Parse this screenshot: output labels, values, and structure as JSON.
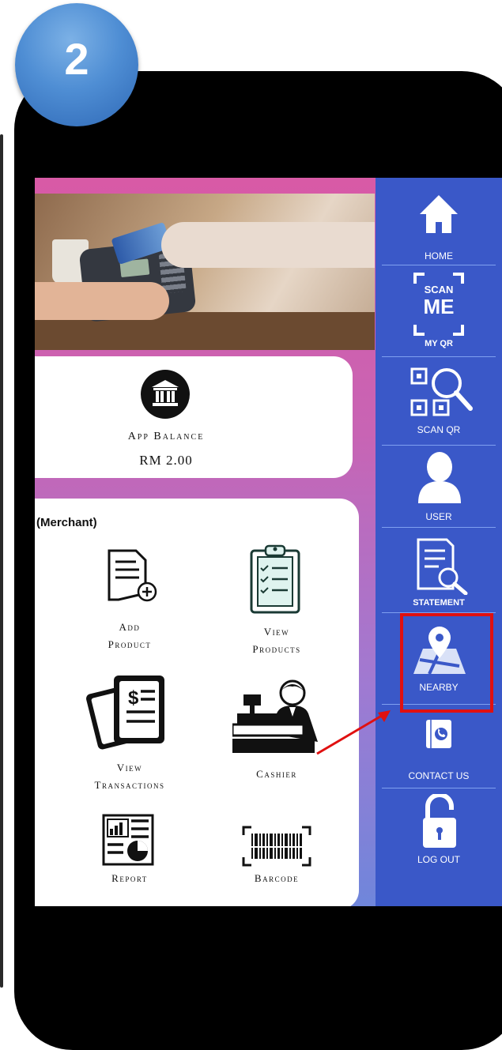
{
  "step_badge": "2",
  "balance": {
    "label": "App Balance",
    "value": "RM 2.00",
    "icon": "bank-icon"
  },
  "merchant_title": "(Merchant)",
  "tiles": [
    {
      "label": "Add\nProduct",
      "icon": "add-product-icon"
    },
    {
      "label": "View\nProducts",
      "icon": "view-products-icon"
    },
    {
      "label": "View\nTransactions",
      "icon": "view-transactions-icon"
    },
    {
      "label": "Cashier",
      "icon": "cashier-icon"
    },
    {
      "label": "Report",
      "icon": "report-icon"
    },
    {
      "label": "Barcode",
      "icon": "barcode-icon"
    }
  ],
  "sidebar": {
    "items": [
      {
        "label": "HOME",
        "icon": "home-icon"
      },
      {
        "label": "MY QR",
        "icon": "scan-me-qr-icon",
        "badge_top": "SCAN",
        "badge_main": "ME"
      },
      {
        "label": "SCAN QR",
        "icon": "scan-qr-icon"
      },
      {
        "label": "USER",
        "icon": "user-icon"
      },
      {
        "label": "STATEMENT",
        "icon": "statement-icon"
      },
      {
        "label": "NEARBY",
        "icon": "map-pin-icon"
      },
      {
        "label": "CONTACT US",
        "icon": "phone-icon"
      },
      {
        "label": "LOG OUT",
        "icon": "padlock-icon"
      }
    ],
    "highlighted_item": "NEARBY"
  },
  "colors": {
    "sidebar": "#3a58c8",
    "highlight": "#e01010",
    "badge": "#4f8ed4"
  }
}
